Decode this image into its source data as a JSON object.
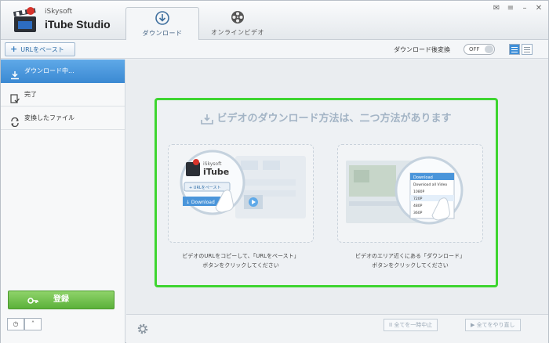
{
  "app": {
    "brand_small": "iSkysoft",
    "brand_big": "iTube Studio"
  },
  "tabs": [
    {
      "label": "ダウンロード",
      "icon": "download-circle-icon"
    },
    {
      "label": "オンラインビデオ",
      "icon": "film-reel-icon"
    }
  ],
  "toolbar": {
    "paste_url": "URLをペースト",
    "convert_after_download": "ダウンロード後変換",
    "toggle_state": "OFF"
  },
  "sidebar": {
    "items": [
      {
        "label": "ダウンロード中...",
        "icon": "download-icon"
      },
      {
        "label": "完了",
        "icon": "completed-icon"
      },
      {
        "label": "変換したファイル",
        "icon": "converted-icon"
      }
    ],
    "register": "登録"
  },
  "main": {
    "headline": "ビデオのダウンロード方法は、二つ方法があります",
    "caption_left_1": "ビデオのURLをコピーして、「URLをペースト」",
    "caption_left_2": "ボタンをクリックしてください",
    "caption_right_1": "ビデオのエリア近くにある「ダウンロード」",
    "caption_right_2": "ボタンをクリックしてください",
    "illustration_left": {
      "brand_small": "iSkysoft",
      "brand_big": "iTube",
      "button": "URLをペースト",
      "download": "Download"
    },
    "illustration_right": {
      "menu": [
        "Download",
        "Download all Video",
        "1080P",
        "720P",
        "480P",
        "360P"
      ]
    }
  },
  "bottom": {
    "stop_all": "全てを一時中止",
    "resume_all": "全てをやり直し"
  },
  "colors": {
    "accent": "#3c8ad3",
    "highlight": "#3ed530",
    "register": "#5bb13a"
  }
}
